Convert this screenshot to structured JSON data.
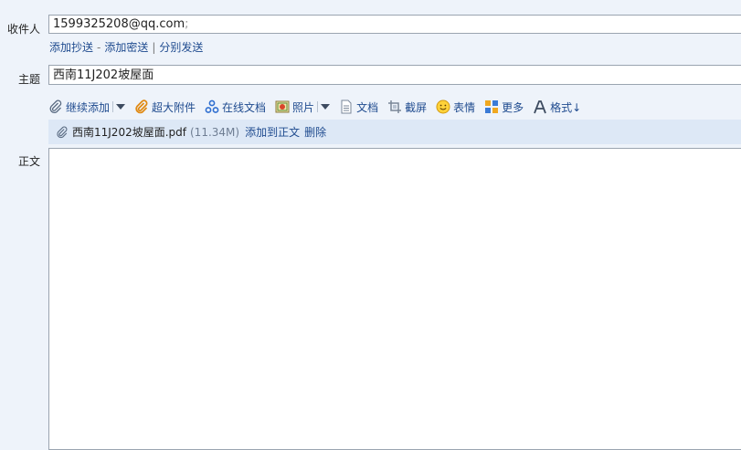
{
  "recipient": {
    "label": "收件人",
    "value": "1599325208@qq.com",
    "separator": ";"
  },
  "recipient_links": {
    "add_cc": "添加抄送",
    "dash": "-",
    "add_bcc": "添加密送",
    "pipe": "|",
    "send_separately": "分别发送"
  },
  "subject": {
    "label": "主题",
    "value": "西南11J202坡屋面"
  },
  "toolbar": {
    "continue_add": "继续添加",
    "large_attachment": "超大附件",
    "online_doc": "在线文档",
    "photo": "照片",
    "document": "文档",
    "screenshot": "截屏",
    "emoji": "表情",
    "more": "更多",
    "format": "格式↓"
  },
  "attachment": {
    "filename": "西南11J202坡屋面.pdf",
    "size": "(11.34M)",
    "add_to_body": "添加到正文",
    "delete": "删除"
  },
  "body": {
    "label": "正文",
    "content": ""
  },
  "colors": {
    "page_bg": "#eef3fa",
    "link": "#1f4b8f",
    "attachment_bg": "#dde8f6"
  }
}
